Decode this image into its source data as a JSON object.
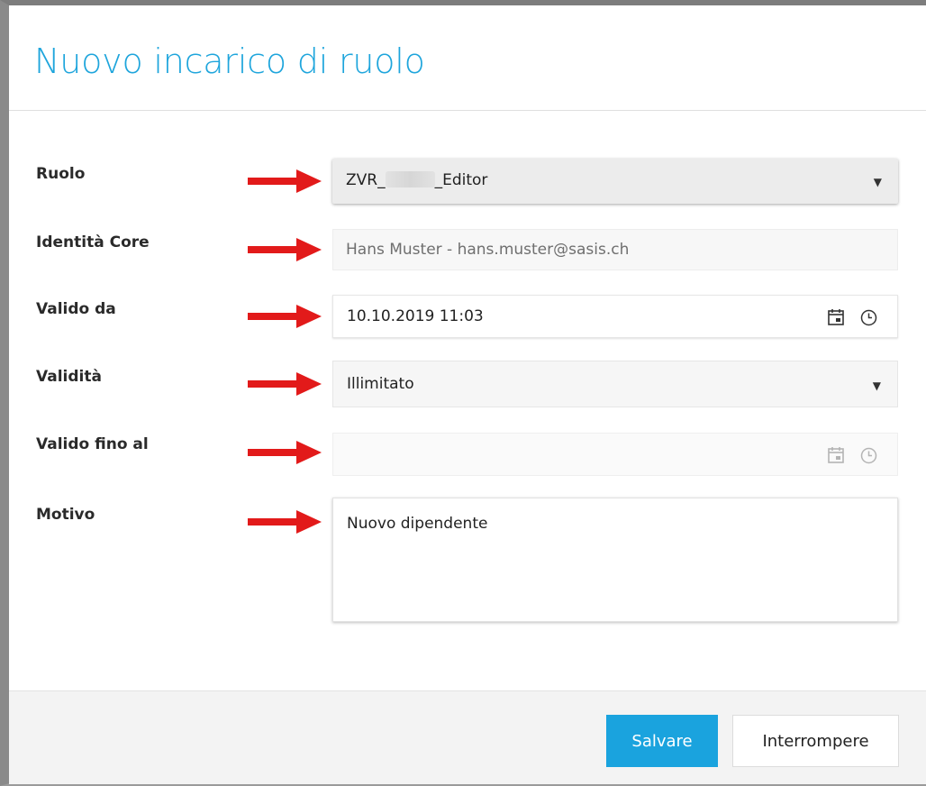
{
  "dialog": {
    "title": "Nuovo incarico di ruolo"
  },
  "fields": {
    "ruolo": {
      "label": "Ruolo",
      "value_prefix": "ZVR_",
      "value_suffix": "_Editor"
    },
    "identita": {
      "label": "Identità Core",
      "value": "Hans Muster -  hans.muster@sasis.ch"
    },
    "valido_da": {
      "label": "Valido da",
      "value": "10.10.2019 11:03"
    },
    "validita": {
      "label": "Validità",
      "value": "Illimitato"
    },
    "valido_fino": {
      "label": "Valido fino al",
      "value": ""
    },
    "motivo": {
      "label": "Motivo",
      "value": "Nuovo dipendente"
    }
  },
  "buttons": {
    "save": "Salvare",
    "cancel": "Interrompere"
  },
  "colors": {
    "accent": "#1aa3de",
    "title": "#1ea5dc",
    "arrow": "#e21a1a"
  }
}
